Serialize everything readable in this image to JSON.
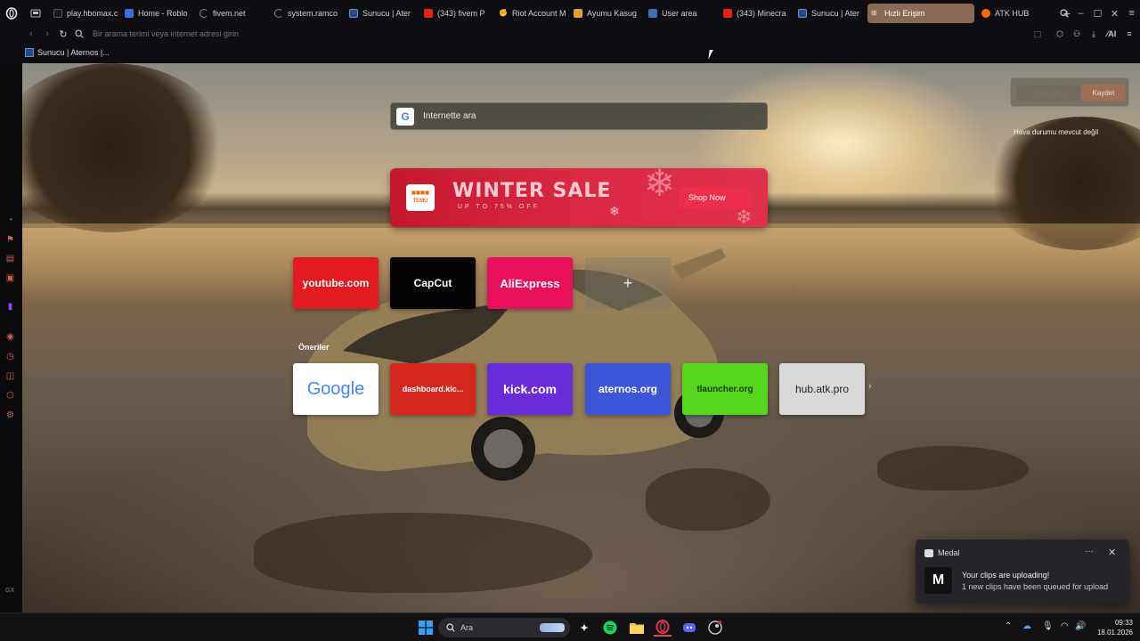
{
  "tabs": [
    {
      "label": "play.hbomax.c",
      "favicon_color": "#1a1a1a",
      "icon": "hbomax-favicon"
    },
    {
      "label": "Home - Roblo",
      "favicon_color": "#ffffff",
      "icon": "roblox-favicon"
    },
    {
      "label": "fivem.net",
      "favicon_color": "#444444",
      "icon": "loading-spinner-icon"
    },
    {
      "label": "system.ramco",
      "favicon_color": "#444444",
      "icon": "loading-spinner-icon"
    },
    {
      "label": "Sunucu | Ater",
      "favicon_color": "#2a6ad0",
      "icon": "aternos-favicon"
    },
    {
      "label": "(343) fivem P",
      "favicon_color": "#e62117",
      "icon": "youtube-favicon"
    },
    {
      "label": "Riot Account M",
      "favicon_color": "#d13639",
      "icon": "riot-favicon"
    },
    {
      "label": "Ayumu Kasug",
      "favicon_color": "#2e51a2",
      "icon": "anime-favicon"
    },
    {
      "label": "User area",
      "favicon_color": "#3b6fb6",
      "icon": "tl-favicon"
    },
    {
      "label": "(343) Minecra",
      "favicon_color": "#e62117",
      "icon": "youtube-favicon"
    },
    {
      "label": "Sunucu | Ater",
      "favicon_color": "#2a6ad0",
      "icon": "aternos-favicon"
    },
    {
      "label": "Hızlı Erişim",
      "favicon_color": "#cccccc",
      "icon": "speed-dial-favicon",
      "active": true
    },
    {
      "label": "ATK HUB",
      "favicon_color": "#ff6a00",
      "icon": "atk-favicon"
    }
  ],
  "address": {
    "placeholder": "Bir arama terimi veya internet adresi girin"
  },
  "bookmarks": [
    {
      "label": "Sunucu | Aternos |..."
    }
  ],
  "search": {
    "placeholder": "İnternette ara"
  },
  "weather": {
    "city_placeholder": "Şehir adı",
    "save_label": "Kaydet",
    "message": "Hava durumu mevcut değil"
  },
  "banner": {
    "brand": "TEMU",
    "title": "WINTER SALE",
    "subtitle": "UP TO 75% OFF",
    "cta": "Shop Now"
  },
  "speed_dial": [
    {
      "label": "youtube.com",
      "bg": "#e21b23",
      "fg": "#ffffff"
    },
    {
      "label": "CapCut",
      "bg": "#050505",
      "fg": "#ffffff"
    },
    {
      "label": "AliExpress",
      "bg": "#e8105a",
      "fg": "#ffffff"
    },
    {
      "label": "+",
      "bg": "transparent",
      "fg": "#eeeeee"
    }
  ],
  "suggestions_title": "Öneriler",
  "suggestions": [
    {
      "label": "Google",
      "bg": "#ffffff",
      "fg": "#4285f4"
    },
    {
      "label": "dashboard.kic...",
      "bg": "#d4261c",
      "fg": "#ffffff"
    },
    {
      "label": "kick.com",
      "bg": "#6a2bd8",
      "fg": "#ffffff"
    },
    {
      "label": "aternos.org",
      "bg": "#3d55d8",
      "fg": "#ffffff"
    },
    {
      "label": "tlauncher.org",
      "bg": "#55d61d",
      "fg": "#1a3a05"
    },
    {
      "label": "hub.atk.pro",
      "bg": "#d9d9d9",
      "fg": "#222222"
    }
  ],
  "notification": {
    "app": "Medal",
    "title": "Your clips are uploading!",
    "body": "1 new clips have been queued for upload"
  },
  "taskbar": {
    "search_placeholder": "Ara",
    "time": "09:33",
    "date": "18.01.2026"
  },
  "sidebar": {
    "bottom_label": "GX"
  }
}
